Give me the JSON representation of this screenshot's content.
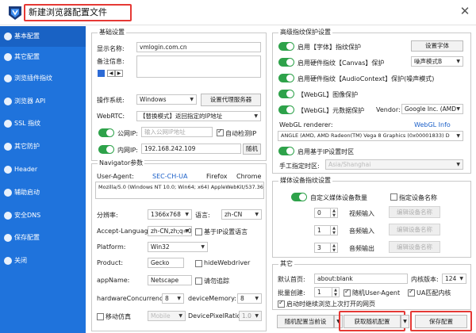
{
  "window": {
    "title": "新建浏览器配置文件",
    "close_glyph": "✕",
    "accent": "#1f73dc"
  },
  "sidebar": {
    "items": [
      {
        "label": "基本配置",
        "icon": "gear-icon",
        "active": true
      },
      {
        "label": "其它配置",
        "icon": "settings-icon"
      },
      {
        "label": "浏览插件指纹",
        "icon": "plugin-icon"
      },
      {
        "label": "浏览器 API",
        "icon": "api-icon"
      },
      {
        "label": "SSL 指纹",
        "icon": "lock-icon"
      },
      {
        "label": "其它防护",
        "icon": "shield-icon"
      },
      {
        "label": "Header",
        "icon": "header-icon"
      },
      {
        "label": "辅助启动",
        "icon": "launch-icon"
      },
      {
        "label": "安全DNS",
        "icon": "dns-icon"
      },
      {
        "label": "保存配置",
        "icon": "save-icon"
      },
      {
        "label": "关闭",
        "icon": "close-icon"
      }
    ]
  },
  "basic": {
    "title": "基础设置",
    "display_name_label": "显示名称:",
    "display_name_value": "vmlogin.com.cn",
    "remark_label": "备注信息:",
    "os_label": "操作系统:",
    "os_value": "Windows",
    "proxy_button": "设置代理服务器",
    "webrtc_label": "WebRTC:",
    "webrtc_value": "【替换模式】返回指定的IP地址",
    "public_ip_label": "公网IP:",
    "public_ip_placeholder": "输入公网IP地址",
    "auto_detect_label": "自动检测IP",
    "lan_ip_label": "内网IP:",
    "lan_ip_value": "192.168.242.109",
    "random_button": "随机"
  },
  "navigator": {
    "title": "Navigator参数",
    "ua_label": "User-Agent:",
    "ua_links": [
      "SEC-CH-UA",
      "Firefox",
      "Chrome"
    ],
    "ua_value": "Mozilla/5.0 (Windows NT 10.0; Win64; x64) AppleWebKit/537.36 (KH",
    "resolution_label": "分辨率:",
    "resolution_value": "1366x768",
    "language_label": "语言:",
    "language_value": "zh-CN",
    "accept_language_label": "Accept-Language:",
    "accept_language_value": "zh-CN,zh;q=0.9",
    "ip_lang_label": "基于IP设置语言",
    "platform_label": "Platform:",
    "platform_value": "Win32",
    "product_label": "Product:",
    "product_value": "Gecko",
    "hide_webdriver_label": "hideWebdriver",
    "appname_label": "appName:",
    "appname_value": "Netscape",
    "dnt_label": "请勿追踪",
    "hw_label": "hardwareConcurrency:",
    "hw_value": "8",
    "mem_label": "deviceMemory:",
    "mem_value": "8",
    "mobile_label": "移动仿真",
    "mobile_value": "Mobile",
    "dpr_label": "DevicePixelRatio:",
    "dpr_value": "1.0"
  },
  "fingerprint": {
    "title": "高级指纹保护设置",
    "font_label": "启用【字体】指纹保护",
    "font_button": "设置字体",
    "canvas_label": "启用硬件指纹【Canvas】保护",
    "canvas_mode": "噪声模式B",
    "audio_label": "启用硬件指纹【AudioContext】保护(噪声模式)",
    "webgl_image_label": "【WebGL】图像保护",
    "webgl_meta_label": "【WebGL】元数据保护",
    "vendor_label": "Vendor:",
    "vendor_value": "Google Inc. (AMD",
    "renderer_label": "WebGL renderer:",
    "webgl_info_link": "WebGL Info",
    "renderer_value": "ANGLE (AMD, AMD Radeon(TM) Vega 8 Graphics (0x00001833) D",
    "geo_label": "启用基于IP设置时区",
    "tz_label": "手工指定时区:",
    "tz_value": "Asia/Shanghai"
  },
  "media": {
    "title": "媒体设备指纹设置",
    "custom_label": "自定义媒体设备数量",
    "names_label": "指定设备名称",
    "rows": [
      {
        "count": "0",
        "label": "视频输入",
        "button": "编辑设备名称"
      },
      {
        "count": "1",
        "label": "音频输入",
        "button": "编辑设备名称"
      },
      {
        "count": "3",
        "label": "音频输出",
        "button": "编辑设备名称"
      }
    ]
  },
  "other": {
    "title": "其它",
    "homepage_label": "默认首页:",
    "homepage_value": "about:blank",
    "kernel_label": "内核版本:",
    "kernel_value": "124",
    "batch_label": "批量创建:",
    "batch_value": "1",
    "random_ua_label": "随机User-Agent",
    "ua_match_label": "UA匹配内核",
    "restore_label": "启动时继续浏览上次打开的网页"
  },
  "footer": {
    "random_config_button": "随机配置当前设",
    "get_random_button": "获取随机配置",
    "save_button": "保存配置"
  }
}
